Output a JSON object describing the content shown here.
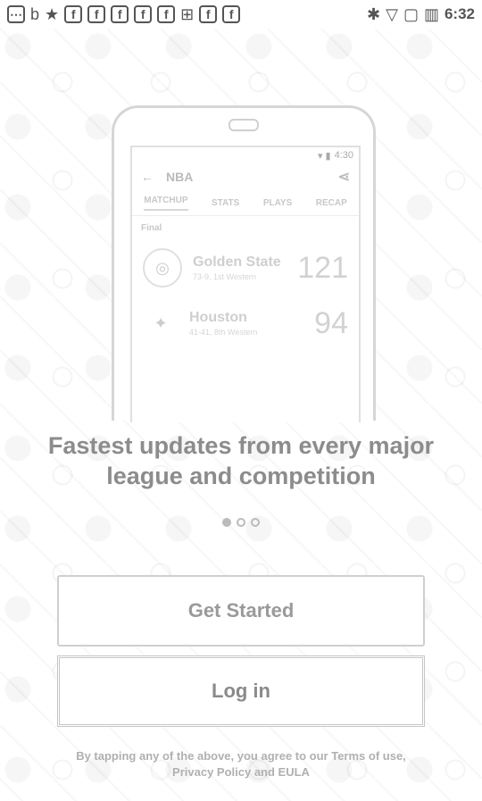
{
  "status_bar": {
    "time": "6:32",
    "left_icons": [
      "⋯",
      "b",
      "★",
      "f",
      "f",
      "f",
      "f",
      "f",
      "⊞",
      "f",
      "f"
    ],
    "right_icons": [
      "✱",
      "▽",
      "▢",
      "▥"
    ]
  },
  "phone_preview": {
    "status_time": "4:30",
    "toolbar_title": "NBA",
    "tabs": [
      "MATCHUP",
      "STATS",
      "PLAYS",
      "RECAP"
    ],
    "section_label": "Final",
    "teams": [
      {
        "name": "Golden State",
        "record": "73-9, 1st Western",
        "score": "121"
      },
      {
        "name": "Houston",
        "record": "41-41, 8th Western",
        "score": "94"
      }
    ]
  },
  "headline": "Fastest updates from every major league and competition",
  "pager": {
    "count": 3,
    "active_index": 0
  },
  "buttons": {
    "get_started": "Get Started",
    "log_in": "Log in"
  },
  "legal": "By tapping any of the above, you agree to our Terms of use, Privacy Policy and EULA"
}
